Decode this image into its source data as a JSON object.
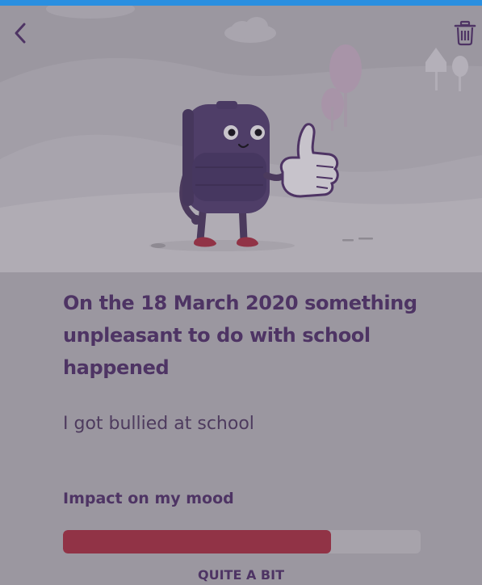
{
  "header": {
    "back_icon": "chevron-left-icon",
    "delete_icon": "trash-icon",
    "accent_color": "#2a8fe0"
  },
  "entry": {
    "title": "On the 18 March 2020 something unpleasant to do with school happened",
    "description": "I got bullied at school"
  },
  "mood": {
    "label": "Impact on my mood",
    "level_fraction": 0.75,
    "level_text": "QUITE A BIT",
    "fill_color": "#913346"
  },
  "illustration": {
    "subject": "purple-backpack-character-thumbs-up"
  }
}
